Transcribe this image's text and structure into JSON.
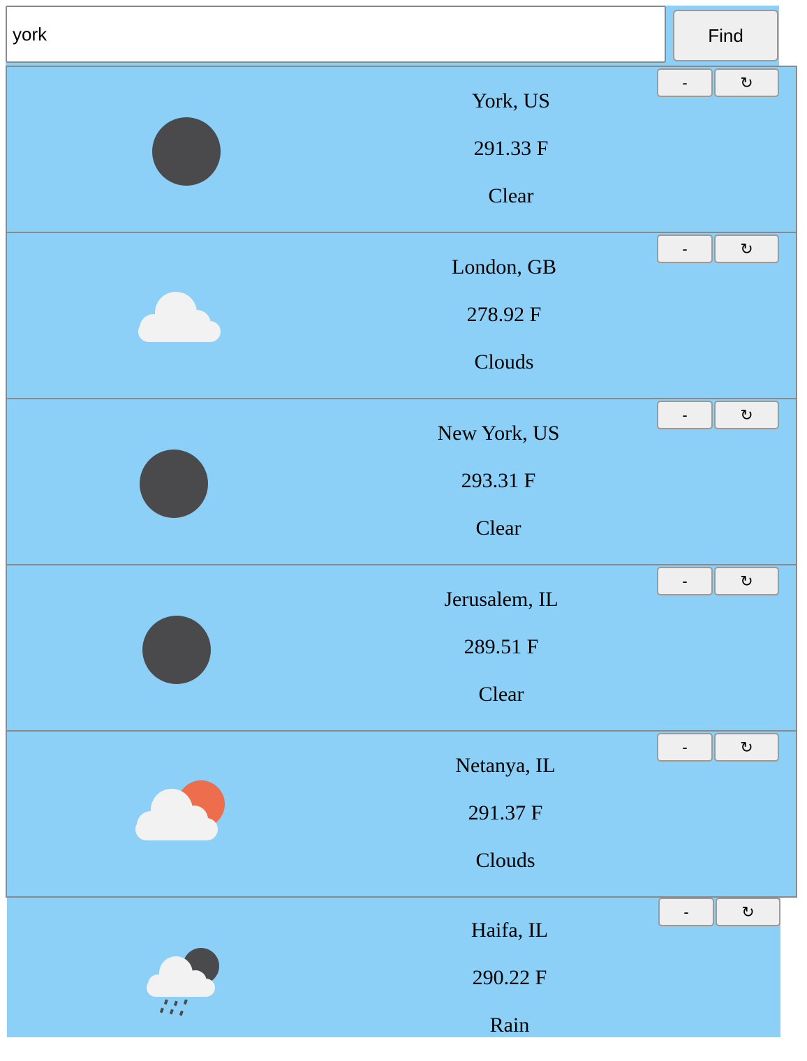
{
  "search": {
    "value": "york",
    "button_label": "Find"
  },
  "card_buttons": {
    "remove_label": "-",
    "refresh_label": "↻"
  },
  "cards": [
    {
      "city": "York, US",
      "temp": "291.33 F",
      "condition": "Clear",
      "icon": "moon-icon"
    },
    {
      "city": "London, GB",
      "temp": "278.92 F",
      "condition": "Clouds",
      "icon": "cloud-icon"
    },
    {
      "city": "New York, US",
      "temp": "293.31 F",
      "condition": "Clear",
      "icon": "moon-icon"
    },
    {
      "city": "Jerusalem, IL",
      "temp": "289.51 F",
      "condition": "Clear",
      "icon": "moon-icon"
    },
    {
      "city": "Netanya, IL",
      "temp": "291.37 F",
      "condition": "Clouds",
      "icon": "cloud-sun-icon"
    },
    {
      "city": "Haifa, IL",
      "temp": "290.22 F",
      "condition": "Rain",
      "icon": "rain-moon-icon"
    }
  ],
  "colors": {
    "card_background": "#8ccff7",
    "moon": "#4a4a4c",
    "cloud": "#f2f2f2",
    "sun": "#ec6e4c"
  }
}
